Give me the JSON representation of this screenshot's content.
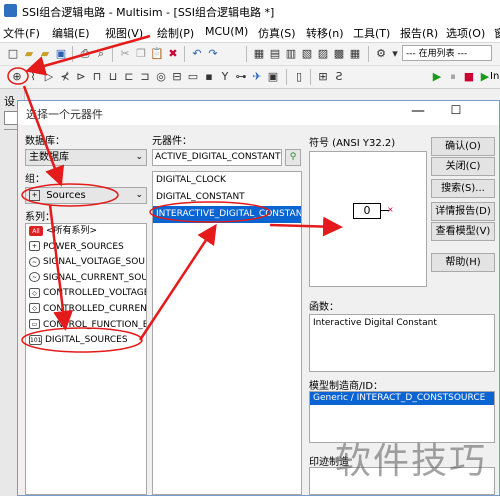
{
  "window": {
    "title": "SSI组合逻辑电路 - Multisim - [SSI组合逻辑电路 *]"
  },
  "menu": [
    "文件(F)",
    "编辑(E)",
    "视图(V)",
    "绘制(P)",
    "MCU(M)",
    "仿真(S)",
    "转移(n)",
    "工具(T)",
    "报告(R)",
    "选项(O)",
    "窗"
  ],
  "toolbar": {
    "list_select": "--- 在用列表 ---",
    "in_label": "In"
  },
  "side_panel": {
    "title": "设"
  },
  "dialog": {
    "title": "选择一个元器件",
    "database_label": "数据库：",
    "database_value": "主数据库",
    "group_label": "组：",
    "group_value": "Sources",
    "family_label": "系列：",
    "families": [
      {
        "label": "<所有系列>",
        "icon": "All"
      },
      {
        "label": "POWER_SOURCES",
        "icon": "Ψ"
      },
      {
        "label": "SIGNAL_VOLTAGE_SOU",
        "icon": "~"
      },
      {
        "label": "SIGNAL_CURRENT_SOU",
        "icon": "~"
      },
      {
        "label": "CONTROLLED_VOLTAGE",
        "icon": "◇"
      },
      {
        "label": "CONTROLLED_CURRENT",
        "icon": "◇"
      },
      {
        "label": "CONTROL_FUNCTION_B",
        "icon": "▭"
      },
      {
        "label": "DIGITAL_SOURCES",
        "icon": "101"
      }
    ],
    "component_label": "元器件：",
    "component_search": "ACTIVE_DIGITAL_CONSTANT",
    "components": [
      "DIGITAL_CLOCK",
      "DIGITAL_CONSTANT",
      "INTERACTIVE_DIGITAL_CONSTAN"
    ],
    "symbol_label": "符号 (ANSI Y32.2)",
    "symbol_value": "0",
    "buttons": {
      "ok": "确认(O)",
      "close": "关闭(C)",
      "search": "搜索(S)...",
      "detail_report": "详情报告(D)",
      "view_model": "查看模型(V)",
      "help": "帮助(H)"
    },
    "function_label": "函数：",
    "function_value": "Interactive Digital Constant",
    "model_label": "模型制造商/ID：",
    "model_value": "Generic / INTERACT_D_CONSTSOURCE",
    "footprint_label": "印迹制造"
  },
  "watermark": "软件技巧",
  "colors": {
    "selection": "#0a64d2",
    "annotation": "#e31b1b"
  }
}
